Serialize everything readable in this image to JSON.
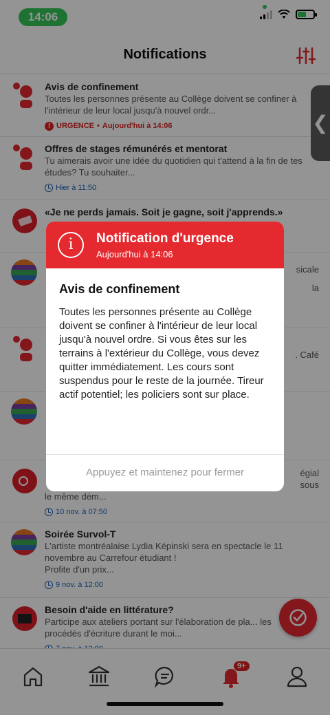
{
  "status_bar": {
    "time": "14:06"
  },
  "header": {
    "title": "Notifications"
  },
  "notifications": [
    {
      "title": "Avis de confinement",
      "body": "Toutes les personnes présente au Collège doivent se confiner à l'intérieur de leur local jusqu'à nouvel ordr...",
      "tag": "URGENCE",
      "time": "Aujourd'hui à 14:06"
    },
    {
      "title": "Offres de stages rémunérés et mentorat",
      "body": "Tu aimerais avoir une idée du quotidien qui t'attend à la fin de tes études? Tu souhaiter...",
      "time": "Hier à 11:50"
    },
    {
      "title": "«Je ne perds jamais. Soit je gagne, soit j'apprends.»",
      "body": "",
      "time": ""
    },
    {
      "title": "",
      "body": "sicale",
      "body2": "la",
      "time": ""
    },
    {
      "title": "",
      "body": ". Café",
      "time": ""
    },
    {
      "title": "",
      "body": "",
      "time": ""
    },
    {
      "title": "",
      "body": "égial",
      "body2": "sous",
      "body3": "le même dém...",
      "time": "10 nov. à 07:50"
    },
    {
      "title": "Soirée Survol-T",
      "body": "L'artiste montréalaise Lydia Képinski sera en spectacle le 11 novembre au Carrefour étudiant !",
      "body2": "Profite d'un prix...",
      "time": "9 nov. à 12:00"
    },
    {
      "title": "Besoin d'aide en littérature?",
      "body": "Participe aux ateliers portant sur l'élaboration de pla... les procédés d'écriture durant le moi...",
      "time": "7 nov. à 12:00"
    }
  ],
  "tab_bar": {
    "items": [
      {
        "name": "home-icon"
      },
      {
        "name": "institution-icon"
      },
      {
        "name": "chat-icon"
      },
      {
        "name": "bell-icon",
        "badge": "9+"
      },
      {
        "name": "profile-icon"
      }
    ]
  },
  "modal": {
    "heading": "Notification d'urgence",
    "date": "Aujourd'hui à 14:06",
    "title": "Avis de confinement",
    "body": "Toutes les personnes présente au Collège doivent se confiner à l'intérieur de leur local jusqu'à nouvel ordre. Si vous êtes sur les terrains à l'extérieur du Collège, vous devez quitter immédiatement. Les cours sont suspendus pour le reste de la journée. Tireur actif potentiel; les policiers sont sur place.",
    "dismiss": "Appuyez et maintenez pour fermer"
  },
  "colors": {
    "accent": "#e4292f",
    "link": "#1d5fb3",
    "status_green": "#34c759"
  }
}
